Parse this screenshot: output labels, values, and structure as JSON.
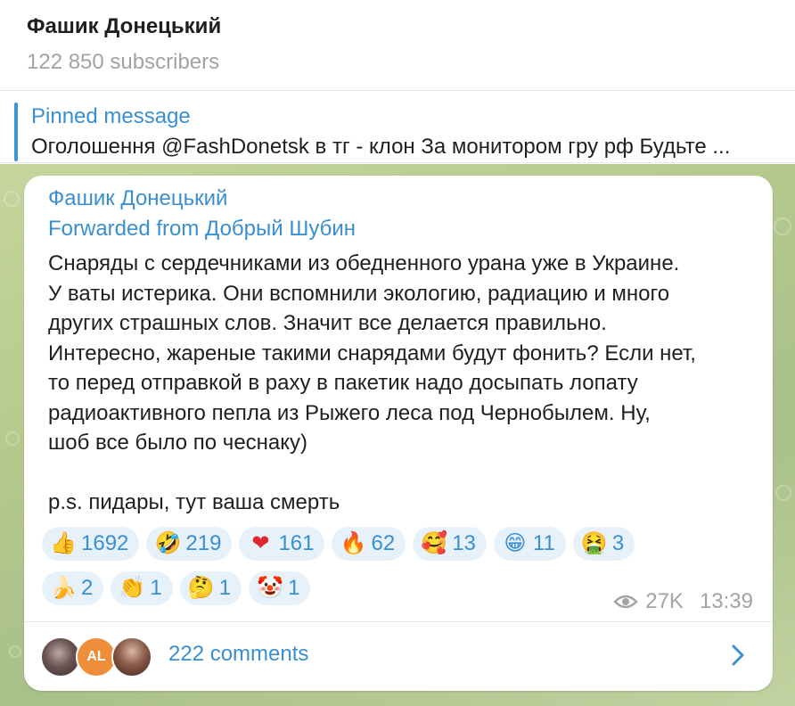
{
  "header": {
    "title": "Фашик Донецький",
    "subscribers": "122 850 subscribers"
  },
  "pinned": {
    "label": "Pinned message",
    "text": "Оголошення  @FashDonetsk в тг -  клон   За монитором гру рф  Будьте ..."
  },
  "post": {
    "author": "Фашик Донецький",
    "forwarded": "Forwarded from Добрый Шубин",
    "lines": [
      "Снаряды с сердечниками из обедненного урана уже в Украине.",
      "У ваты истерика. Они вспомнили экологию, радиацию и много",
      "других страшных слов. Значит все делается правильно.",
      "Интересно, жареные такими снарядами будут фонить? Если нет,",
      "то перед отправкой в раху в пакетик надо досыпать лопату",
      "радиоактивного пепла из Рыжего леса под Чернобылем. Ну,",
      "шоб все было по чеснаку)",
      "",
      "p.s. пидары, тут ваша смерть"
    ],
    "reactions": [
      {
        "icon": "thumbs-up-icon",
        "emoji": "👍",
        "count": "1692"
      },
      {
        "icon": "rofl-icon",
        "emoji": "🤣",
        "count": "219"
      },
      {
        "icon": "heart-icon",
        "emoji": "❤",
        "count": "161"
      },
      {
        "icon": "fire-icon",
        "emoji": "🔥",
        "count": "62"
      },
      {
        "icon": "smiling-face-with-hearts-icon",
        "emoji": "🥰",
        "count": "13"
      },
      {
        "icon": "grinning-face-icon",
        "emoji": "😁",
        "count": "11"
      },
      {
        "icon": "vomiting-face-icon",
        "emoji": "🤮",
        "count": "3"
      },
      {
        "icon": "banana-icon",
        "emoji": "🍌",
        "count": "2"
      },
      {
        "icon": "clapping-hands-icon",
        "emoji": "👏",
        "count": "1"
      },
      {
        "icon": "thinking-face-icon",
        "emoji": "🤔",
        "count": "1"
      },
      {
        "icon": "clown-face-icon",
        "emoji": "🤡",
        "count": "1"
      }
    ],
    "views": "27K",
    "time": "13:39",
    "comments": {
      "label": "222 comments",
      "avatar_initials": "AL"
    }
  },
  "colors": {
    "accent": "#3a8fd0",
    "pill_bg": "#e7f1fa",
    "chat_bg": "#b5c98e"
  }
}
